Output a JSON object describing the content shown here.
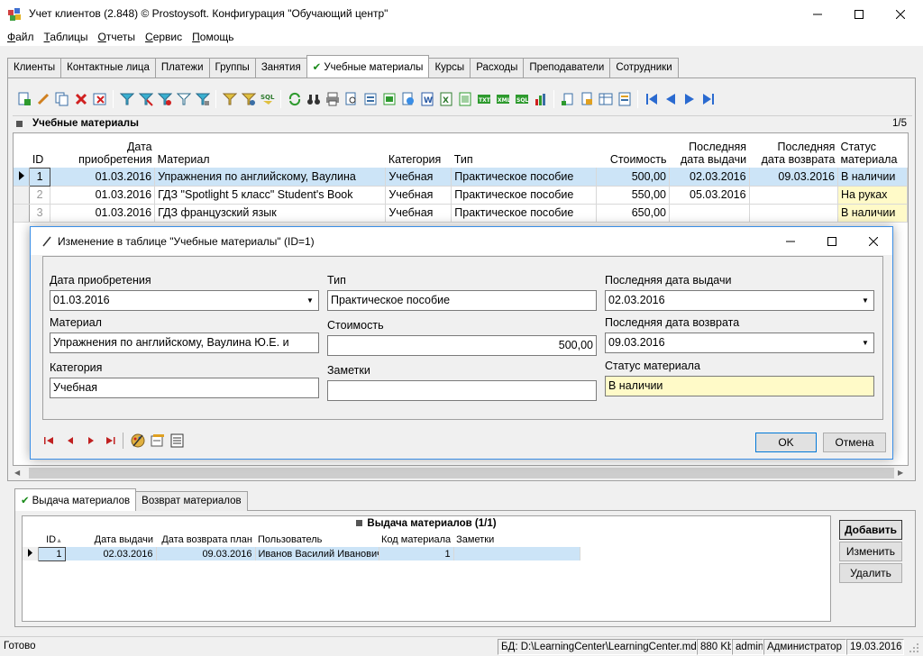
{
  "window": {
    "title": "Учет клиентов (2.848) © Prostoysoft. Конфигурация \"Обучающий центр\""
  },
  "menu": {
    "items": [
      {
        "u": "Ф",
        "rest": "айл"
      },
      {
        "u": "Т",
        "rest": "аблицы"
      },
      {
        "u": "О",
        "rest": "тчеты"
      },
      {
        "u": "С",
        "rest": "ервис"
      },
      {
        "u": "П",
        "rest": "омощь"
      }
    ]
  },
  "tabs": [
    "Клиенты",
    "Контактные лица",
    "Платежи",
    "Группы",
    "Занятия",
    "Учебные материалы",
    "Курсы",
    "Расходы",
    "Преподаватели",
    "Сотрудники"
  ],
  "grid": {
    "title": "Учебные материалы",
    "pager": "1/5",
    "columns": {
      "id": "ID",
      "date": "Дата приобретения",
      "material": "Материал",
      "category": "Категория",
      "type": "Тип",
      "cost": "Стоимость",
      "last_issue": "Последняя дата выдачи",
      "last_return": "Последняя дата возврата",
      "status": "Статус материала"
    },
    "rows": [
      {
        "id": "1",
        "date": "01.03.2016",
        "material": "Упражнения по английскому, Ваулина",
        "category": "Учебная",
        "type": "Практическое пособие",
        "cost": "500,00",
        "last_issue": "02.03.2016",
        "last_return": "09.03.2016",
        "status": "В наличии"
      },
      {
        "id": "2",
        "date": "01.03.2016",
        "material": "ГДЗ \"Spotlight 5 класс\" Student's Book",
        "category": "Учебная",
        "type": "Практическое пособие",
        "cost": "550,00",
        "last_issue": "05.03.2016",
        "last_return": "",
        "status": "На руках"
      },
      {
        "id": "3",
        "date": "01.03.2016",
        "material": "ГДЗ французский язык",
        "category": "Учебная",
        "type": "Практическое пособие",
        "cost": "650,00",
        "last_issue": "",
        "last_return": "",
        "status": "В наличии"
      }
    ]
  },
  "dialog": {
    "title": "Изменение в таблице \"Учебные материалы\" (ID=1)",
    "fields": {
      "date_label": "Дата приобретения",
      "date_value": "01.03.2016",
      "material_label": "Материал",
      "material_value": "Упражнения по английскому, Ваулина Ю.Е. и",
      "category_label": "Категория",
      "category_value": "Учебная",
      "type_label": "Тип",
      "type_value": "Практическое пособие",
      "cost_label": "Стоимость",
      "cost_value": "500,00",
      "notes_label": "Заметки",
      "notes_value": "",
      "last_issue_label": "Последняя дата выдачи",
      "last_issue_value": "02.03.2016",
      "last_return_label": "Последняя дата возврата",
      "last_return_value": "09.03.2016",
      "status_label": "Статус материала",
      "status_value": "В наличии"
    },
    "ok": "OK",
    "cancel": "Отмена"
  },
  "bottom_tabs": [
    "Выдача материалов",
    "Возврат материалов"
  ],
  "subgrid": {
    "title": "Выдача материалов (1/1)",
    "columns": {
      "id": "ID",
      "issue_date": "Дата выдачи",
      "return_plan": "Дата возврата план",
      "user": "Пользователь",
      "code": "Код материала",
      "notes": "Заметки"
    },
    "rows": [
      {
        "id": "1",
        "issue_date": "02.03.2016",
        "return_plan": "09.03.2016",
        "user": "Иванов Василий Иванович",
        "code": "1",
        "notes": ""
      }
    ]
  },
  "side_buttons": {
    "add": "Добавить",
    "edit": "Изменить",
    "delete": "Удалить"
  },
  "status": {
    "ready": "Готово",
    "db_label": "БД:",
    "db_path": "D:\\LearningCenter\\LearningCenter.mdb",
    "size": "880 Kb",
    "user": "admin",
    "role": "Администратор",
    "date": "19.03.2016"
  },
  "colors": {
    "selection": "#cce4f7",
    "status_yellow": "#fffac8",
    "accent": "#0078d7"
  }
}
